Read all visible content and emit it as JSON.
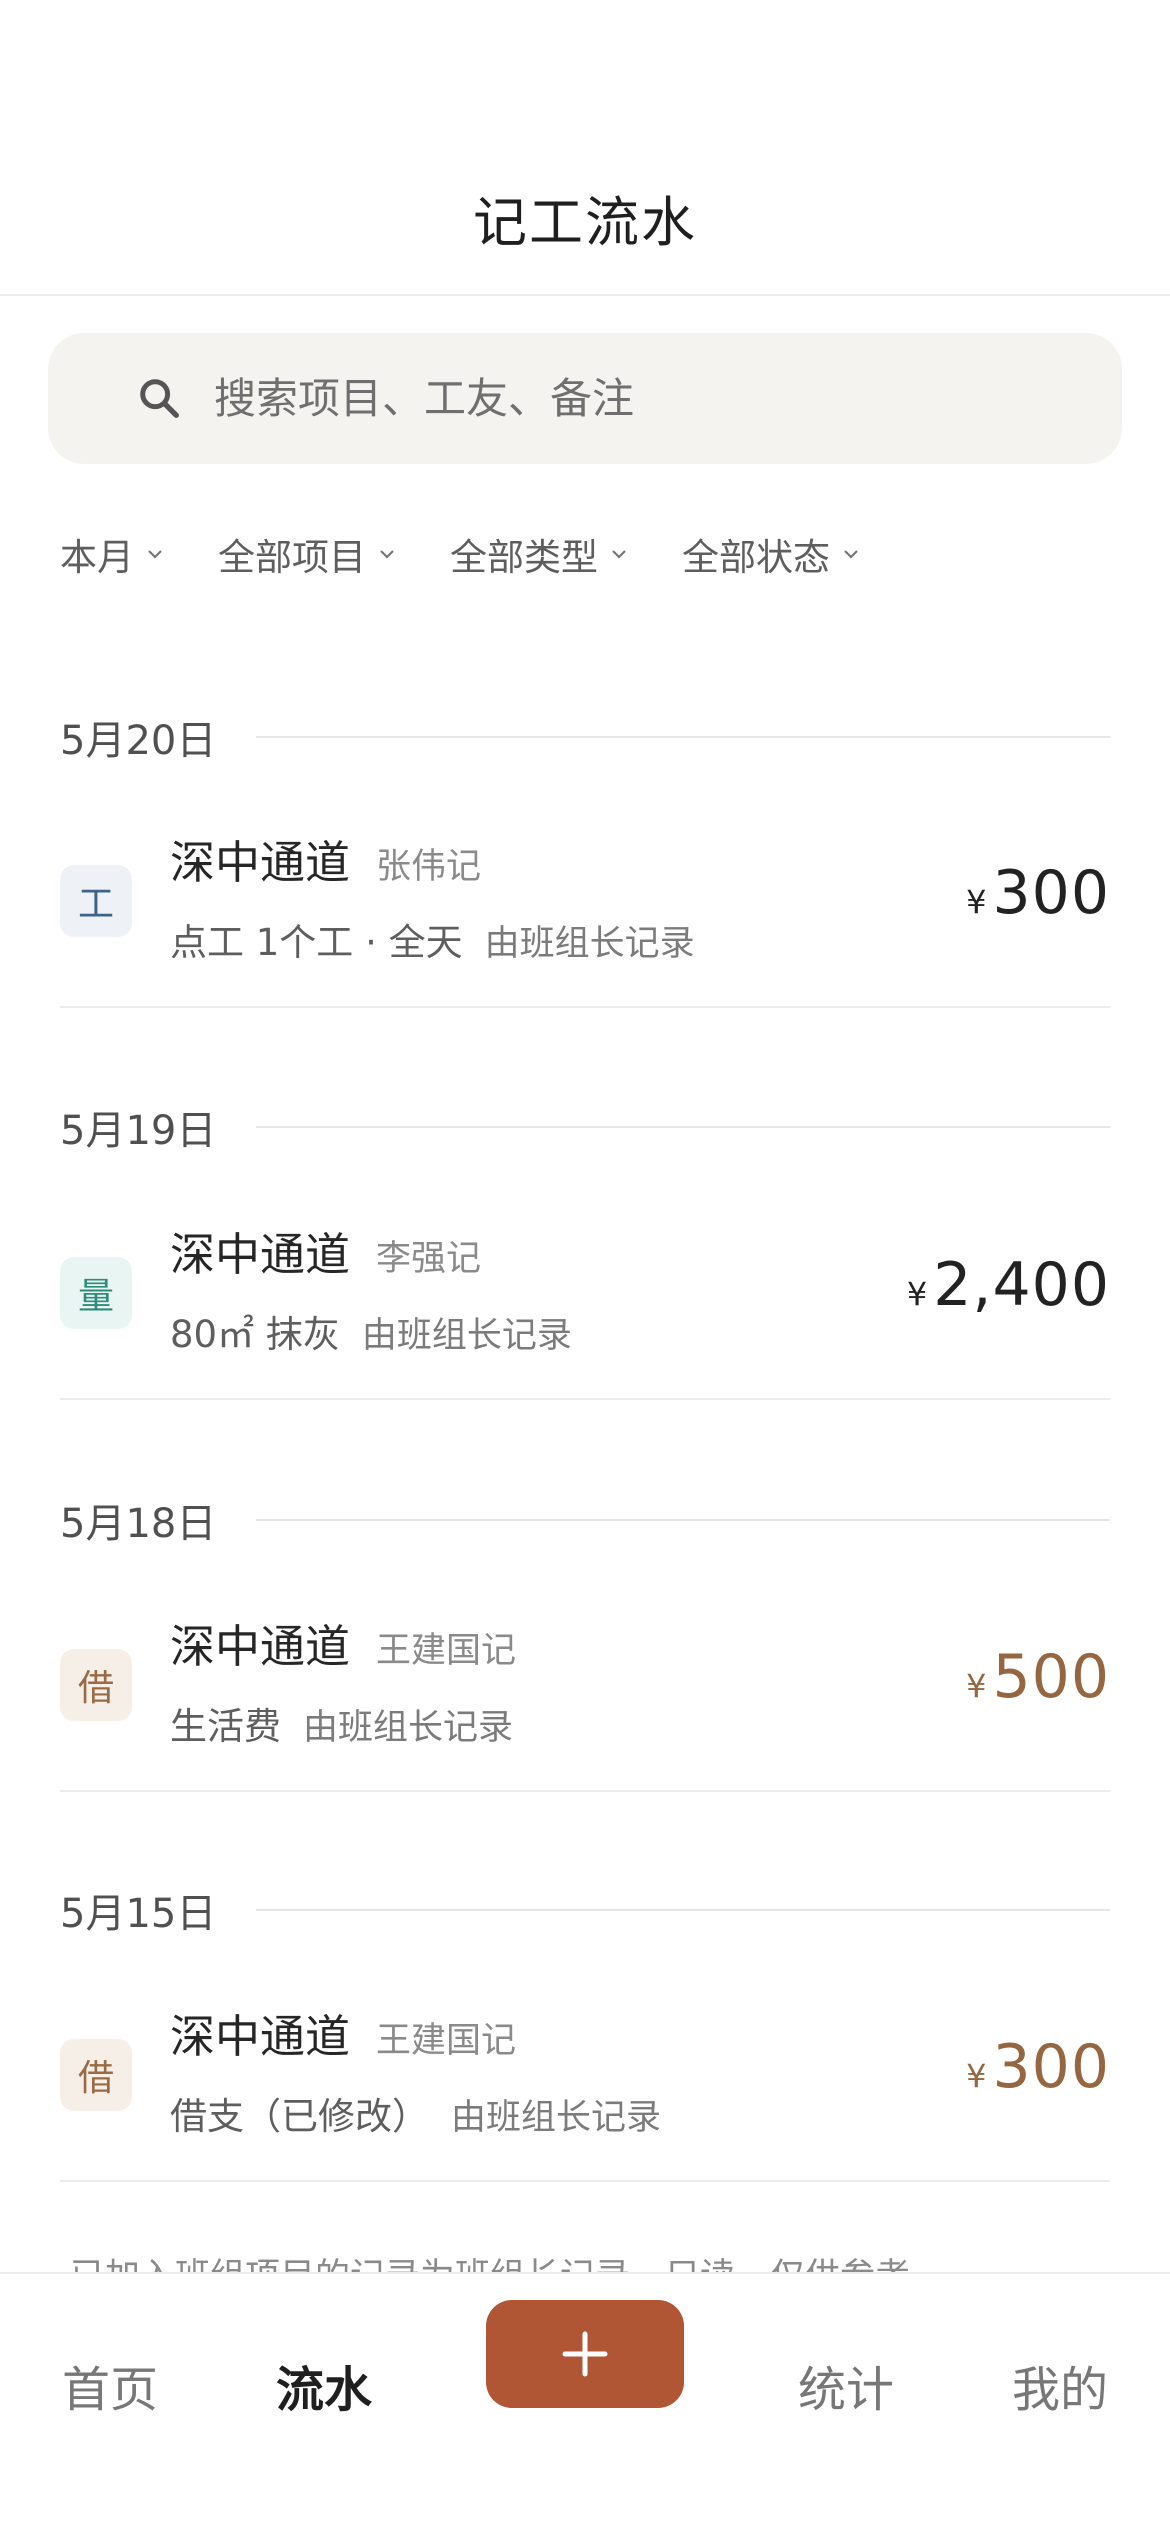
{
  "header": {
    "title": "记工流水"
  },
  "search": {
    "placeholder": "搜索项目、工友、备注",
    "value": ""
  },
  "filters": [
    {
      "label": "本月"
    },
    {
      "label": "全部项目"
    },
    {
      "label": "全部类型"
    },
    {
      "label": "全部状态"
    }
  ],
  "groups": [
    {
      "date": "5月20日",
      "record": {
        "tag": "工",
        "project": "深中通道",
        "recorder": "张伟记",
        "desc": "点工 1个工 · 全天",
        "source": "由班组长记录",
        "currency": "¥",
        "amount": "300"
      }
    },
    {
      "date": "5月19日",
      "record": {
        "tag": "量",
        "project": "深中通道",
        "recorder": "李强记",
        "desc": "80㎡ 抹灰",
        "source": "由班组长记录",
        "currency": "¥",
        "amount": "2,400"
      }
    },
    {
      "date": "5月18日",
      "record": {
        "tag": "借",
        "project": "深中通道",
        "recorder": "王建国记",
        "desc": "生活费",
        "source": "由班组长记录",
        "currency": "¥",
        "amount": "500"
      }
    },
    {
      "date": "5月15日",
      "record": {
        "tag": "借",
        "project": "深中通道",
        "recorder": "王建国记",
        "desc": "借支（已修改）",
        "source": "由班组长记录",
        "currency": "¥",
        "amount": "300"
      }
    }
  ],
  "footnote": "已加入班组项目的记录为班组长记录，只读，仅供参考",
  "tabbar": {
    "home": "首页",
    "ledger": "流水",
    "stats": "统计",
    "mine": "我的"
  },
  "colors": {
    "accent": "#b05634",
    "amount_income": "#222222",
    "amount_loan": "#956640",
    "tag_work": "#3e6288",
    "tag_quantity": "#2d8b7b",
    "tag_loan": "#9a6a44"
  }
}
